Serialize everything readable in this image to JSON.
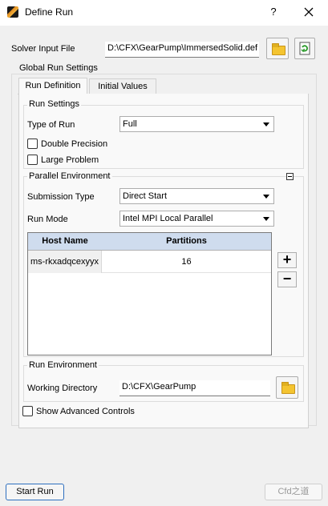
{
  "window": {
    "title": "Define Run",
    "help_label": "?"
  },
  "solver_input": {
    "label": "Solver Input File",
    "value": "D:\\CFX\\GearPump\\ImmersedSolid.def"
  },
  "global_run_settings": {
    "title": "Global Run Settings"
  },
  "tabs": [
    {
      "label": "Run Definition",
      "active": true
    },
    {
      "label": "Initial Values",
      "active": false
    }
  ],
  "run_settings": {
    "title": "Run Settings",
    "type_of_run": {
      "label": "Type of Run",
      "value": "Full"
    },
    "double_precision": {
      "label": "Double Precision",
      "checked": false
    },
    "large_problem": {
      "label": "Large Problem",
      "checked": false
    }
  },
  "parallel_environment": {
    "title": "Parallel Environment",
    "submission_type": {
      "label": "Submission Type",
      "value": "Direct Start"
    },
    "run_mode": {
      "label": "Run Mode",
      "value": "Intel MPI Local Parallel"
    },
    "table": {
      "columns": [
        "Host Name",
        "Partitions"
      ],
      "rows": [
        {
          "host": "ms-rkxadqcexyyx",
          "partitions": "16"
        }
      ]
    },
    "add_label": "+",
    "remove_label": "−"
  },
  "run_environment": {
    "title": "Run Environment",
    "working_directory": {
      "label": "Working Directory",
      "value": "D:\\CFX\\GearPump"
    }
  },
  "show_advanced": {
    "label": "Show Advanced Controls",
    "checked": false
  },
  "footer": {
    "start_run_label": "Start Run",
    "watermark": "Cfd之道"
  },
  "colors": {
    "accent": "#2e6fbf",
    "table_header": "#cfdcee"
  }
}
